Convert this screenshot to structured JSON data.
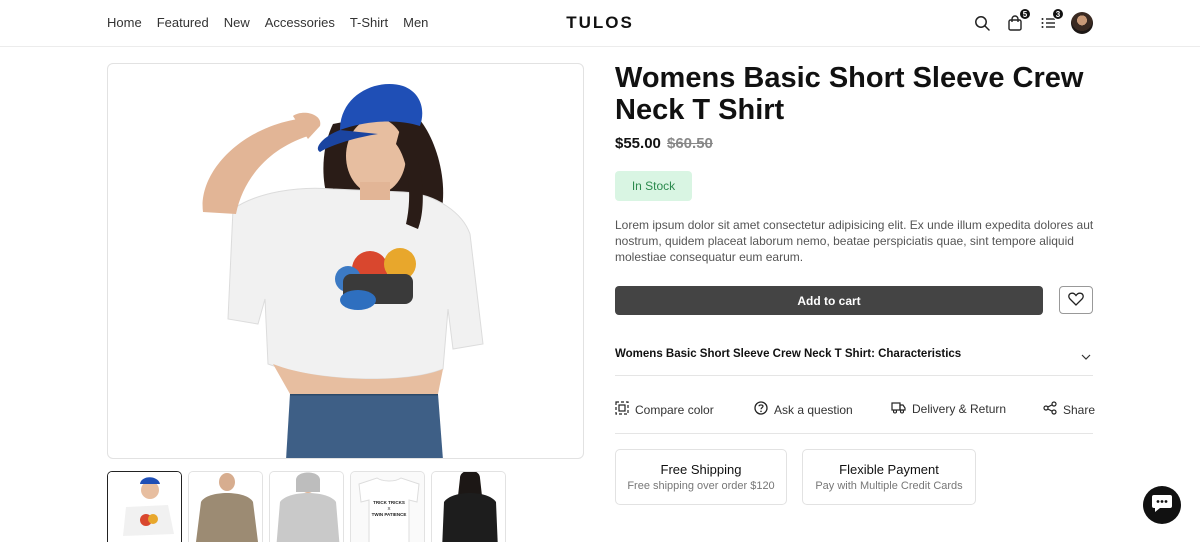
{
  "nav": {
    "links": [
      "Home",
      "Featured",
      "New",
      "Accessories",
      "T-Shirt",
      "Men"
    ],
    "logo": "TULOS"
  },
  "header_icons": {
    "cart_count": "5",
    "compare_count": "3"
  },
  "product": {
    "title": "Womens Basic Short Sleeve Crew Neck T Shirt",
    "price": "$55.00",
    "old_price": "$60.50",
    "stock": "In Stock",
    "description": "Lorem ipsum dolor sit amet consectetur adipisicing elit. Ex unde illum expedita dolores aut nostrum, quidem placeat laborum nemo, beatae perspiciatis quae, sint tempore aliquid molestiae consequatur eum earum.",
    "add_to_cart": "Add to cart",
    "characteristics": "Womens Basic Short Sleeve Crew Neck T Shirt: Characteristics"
  },
  "actions": {
    "compare": "Compare color",
    "ask": "Ask a question",
    "delivery": "Delivery & Return",
    "share": "Share"
  },
  "cards": {
    "shipping_title": "Free Shipping",
    "shipping_sub": "Free shipping over order $120",
    "payment_title": "Flexible Payment",
    "payment_sub": "Pay with Multiple Credit Cards"
  },
  "thumbnails": {
    "tee_text": "TRICK TRICKS\nX\nTWIN PATIENCE"
  },
  "colors": {
    "accent_dark": "#444444",
    "stock_bg": "#d9f5e3",
    "stock_text": "#2b8a4d"
  }
}
